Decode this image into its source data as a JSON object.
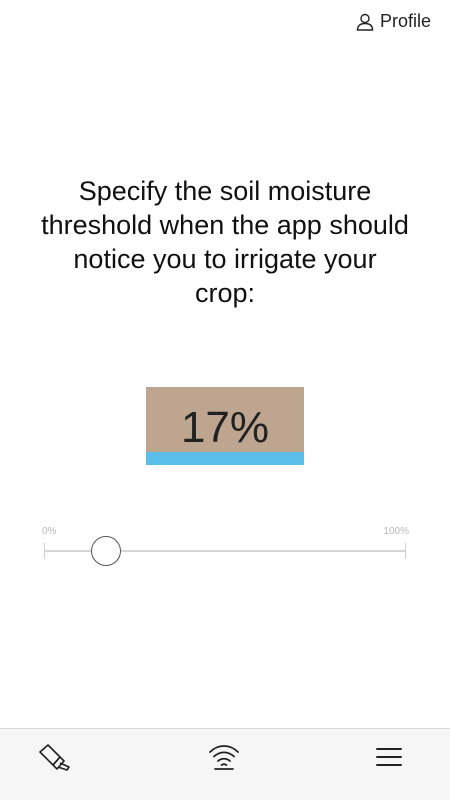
{
  "header": {
    "profile_label": "Profile",
    "profile_icon": "user-icon"
  },
  "prompt": {
    "text": "Specify the soil moisture threshold when the app should notice you to irrigate your crop:"
  },
  "moisture": {
    "value": 17,
    "value_label": "17%",
    "soil_color": "#bea58f",
    "water_color": "#5bbde9"
  },
  "slider": {
    "min_label": "0%",
    "max_label": "100%",
    "value": 17
  },
  "bottom_nav": {
    "items": [
      {
        "icon": "watering-can-icon"
      },
      {
        "icon": "wifi-signal-icon"
      },
      {
        "icon": "hamburger-menu-icon"
      }
    ]
  }
}
